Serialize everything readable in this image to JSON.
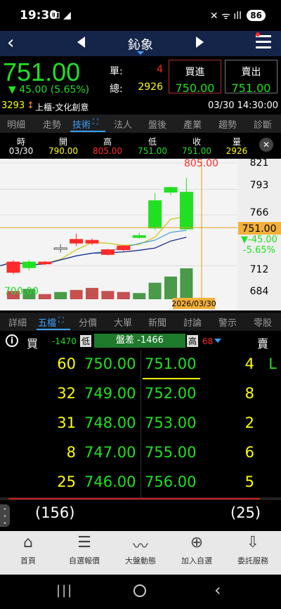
{
  "status": {
    "time": "19:30",
    "battery": "86"
  },
  "header": {
    "title": "鈊象"
  },
  "quote": {
    "price": "751.00",
    "change": "▼ 45.00 (5.65%)",
    "single_label": "單:",
    "single_value": "4",
    "total_label": "總:",
    "total_value": "2926",
    "buy_label": "買進",
    "buy_price": "750.00",
    "sell_label": "賣出",
    "sell_price": "751.00",
    "code": "3293",
    "market": "上櫃-文化創意",
    "datetime": "03/30 14:30:00"
  },
  "tabs": [
    "明細",
    "走勢",
    "技術",
    "法人",
    "盤後",
    "產業",
    "趨勢",
    "診斷"
  ],
  "ohlc": {
    "headers": [
      "時",
      "開",
      "高",
      "低",
      "收",
      "量"
    ],
    "values": [
      "03/30",
      "790.00",
      "805.00",
      "751.00",
      "751.00",
      "2926"
    ]
  },
  "chart_data": {
    "type": "candlestick",
    "y_ticks": [
      "821",
      "793",
      "766",
      "751.00",
      "712",
      "684"
    ],
    "price_tag": "751.00",
    "change_tag": "▼-45.00",
    "pct_tag": "-5.65%",
    "high_label": "805.00",
    "low_label": "700.00",
    "date_label": "2026/03/30",
    "ylim": [
      684,
      821
    ],
    "candles": [
      {
        "o": 705,
        "c": 716,
        "h": 718,
        "l": 703,
        "v": 8
      },
      {
        "o": 716,
        "c": 710,
        "h": 718,
        "l": 707,
        "v": 10
      },
      {
        "o": 714,
        "c": 716,
        "h": 717,
        "l": 713,
        "v": 5
      },
      {
        "o": 731,
        "c": 731,
        "h": 735,
        "l": 726,
        "v": 7
      },
      {
        "o": 736,
        "c": 740,
        "h": 746,
        "l": 733,
        "v": 9
      },
      {
        "o": 736,
        "c": 739,
        "h": 741,
        "l": 734,
        "v": 11
      },
      {
        "o": 724,
        "c": 729,
        "h": 730,
        "l": 723,
        "v": 8
      },
      {
        "o": 729,
        "c": 733,
        "h": 734,
        "l": 727,
        "v": 7
      },
      {
        "o": 744,
        "c": 742,
        "h": 747,
        "l": 741,
        "v": 6
      },
      {
        "o": 781,
        "c": 752,
        "h": 789,
        "l": 750,
        "v": 16
      },
      {
        "o": 795,
        "c": 790,
        "h": 796,
        "l": 787,
        "v": 22
      },
      {
        "o": 790,
        "c": 751,
        "h": 805,
        "l": 751,
        "v": 30
      }
    ]
  },
  "book_tabs": [
    "詳細",
    "五檔",
    "分價",
    "大單",
    "新聞",
    "討論",
    "警示",
    "零股"
  ],
  "book_header": {
    "buy_label": "買",
    "buy_diff": "-1470",
    "low_label": "低",
    "spread": "盤差 -1466",
    "high_label": "高",
    "high_value": "68",
    "sell_label": "賣"
  },
  "book": [
    {
      "bq": "60",
      "bp": "750.00",
      "sp": "751.00",
      "sq": "4",
      "flag": "L"
    },
    {
      "bq": "32",
      "bp": "749.00",
      "sp": "752.00",
      "sq": "8",
      "flag": ""
    },
    {
      "bq": "31",
      "bp": "748.00",
      "sp": "753.00",
      "sq": "2",
      "flag": ""
    },
    {
      "bq": "8",
      "bp": "747.00",
      "sp": "755.00",
      "sq": "6",
      "flag": ""
    },
    {
      "bq": "25",
      "bp": "746.00",
      "sp": "756.00",
      "sq": "5",
      "flag": ""
    }
  ],
  "totals": {
    "buy": "(156)",
    "sell": "(25)"
  },
  "bottom_nav": [
    "首頁",
    "自選報價",
    "大盤動態",
    "加入自選",
    "委託服務"
  ],
  "colors": {
    "up": "#ff2a2a",
    "down": "#21e021",
    "accent": "#3aa0ff",
    "qty": "#ffff00"
  }
}
